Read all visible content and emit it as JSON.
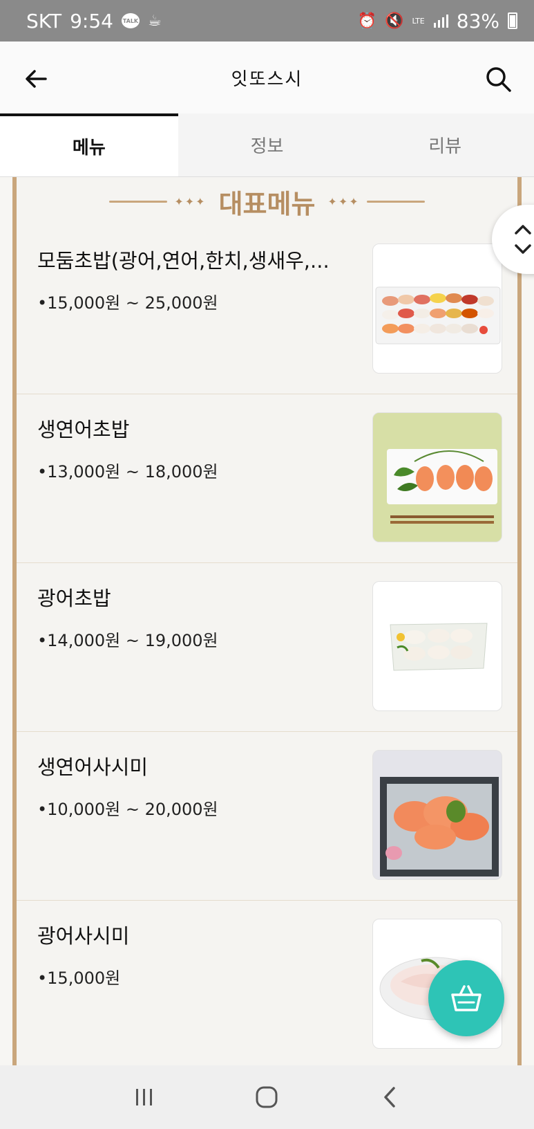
{
  "status_bar": {
    "carrier": "SKT",
    "time": "9:54",
    "talk": "TALK",
    "network": "LTE",
    "battery": "83%"
  },
  "header": {
    "title": "잇또스시"
  },
  "tabs": [
    {
      "label": "메뉴"
    },
    {
      "label": "정보"
    },
    {
      "label": "리뷰"
    }
  ],
  "section": {
    "title": "대표메뉴",
    "deco": "✦✦✦"
  },
  "menu_items": [
    {
      "name": "모둠초밥(광어,연어,한치,생새우,...",
      "price": "•15,000원 ~ 25,000원",
      "image": "assorted-sushi-platter"
    },
    {
      "name": "생연어초밥",
      "price": "•13,000원 ~ 18,000원",
      "image": "salmon-sushi"
    },
    {
      "name": "광어초밥",
      "price": "•14,000원 ~ 19,000원",
      "image": "flatfish-sushi"
    },
    {
      "name": "생연어사시미",
      "price": "•10,000원 ~ 20,000원",
      "image": "salmon-sashimi"
    },
    {
      "name": "광어사시미",
      "price": "•15,000원",
      "image": "flatfish-sashimi"
    }
  ],
  "colors": {
    "accent": "#c9a67c",
    "fab": "#2ec4b6",
    "status_bar": "#8a8a8a"
  },
  "icons": [
    "back-arrow-icon",
    "search-icon",
    "chevron-up-icon",
    "chevron-down-icon",
    "basket-icon",
    "recent-apps-icon",
    "home-icon",
    "nav-back-icon"
  ]
}
